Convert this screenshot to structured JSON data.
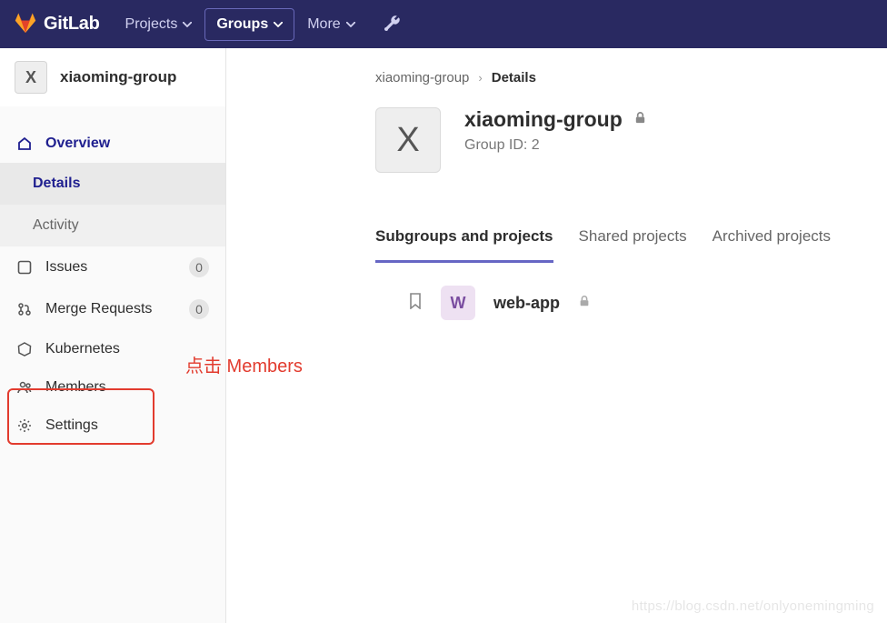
{
  "navbar": {
    "logo_text": "GitLab",
    "projects": "Projects",
    "groups": "Groups",
    "more": "More"
  },
  "sidebar": {
    "group_initial": "X",
    "group_name": "xiaoming-group",
    "overview": "Overview",
    "details": "Details",
    "activity": "Activity",
    "issues": "Issues",
    "issues_count": "0",
    "merge_requests": "Merge Requests",
    "mr_count": "0",
    "kubernetes": "Kubernetes",
    "members": "Members",
    "settings": "Settings"
  },
  "breadcrumb": {
    "root": "xiaoming-group",
    "current": "Details"
  },
  "hero": {
    "initial": "X",
    "title": "xiaoming-group",
    "subtitle": "Group ID: 2"
  },
  "tabs": {
    "subgroups": "Subgroups and projects",
    "shared": "Shared projects",
    "archived": "Archived projects"
  },
  "project": {
    "initial": "W",
    "name": "web-app"
  },
  "annotation": "点击 Members",
  "watermark": "https://blog.csdn.net/onlyonemingming"
}
